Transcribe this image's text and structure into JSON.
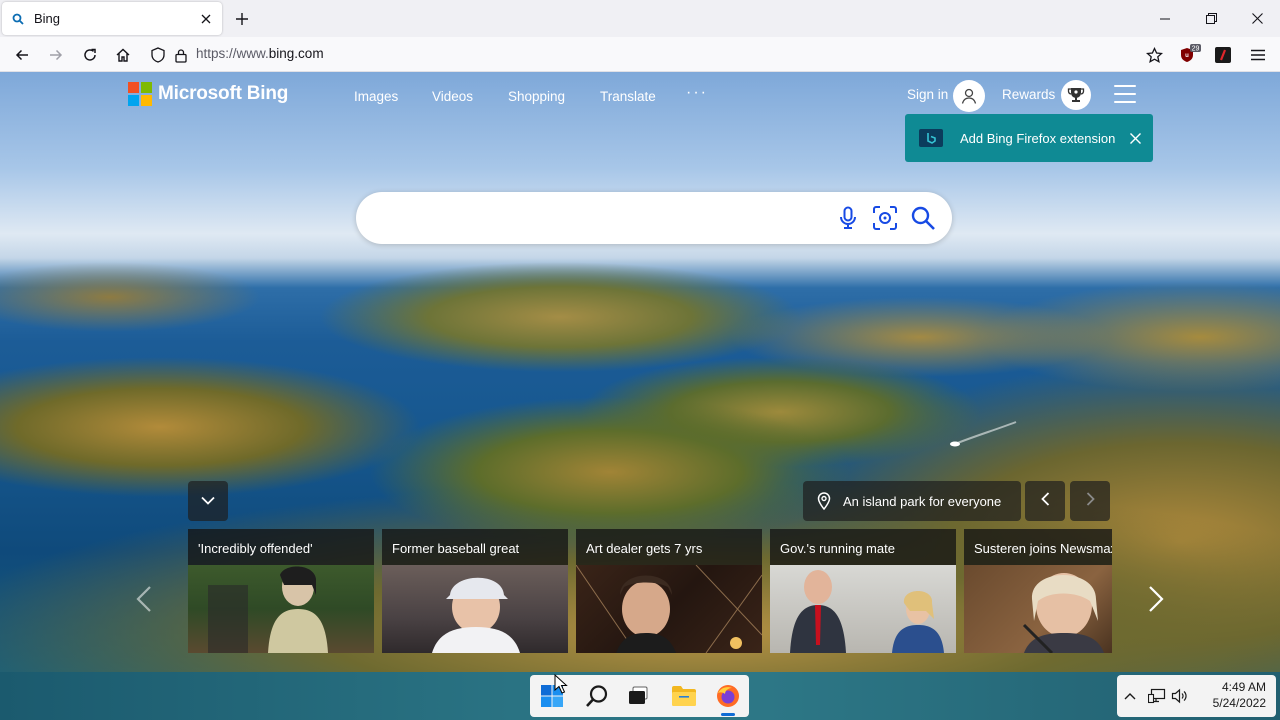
{
  "browser": {
    "tab": {
      "title": "Bing"
    },
    "url": {
      "scheme": "https://www.",
      "host": "bing.com"
    },
    "extension_badge_count": "29"
  },
  "header": {
    "logo_text": "Microsoft Bing",
    "nav": [
      "Images",
      "Videos",
      "Shopping",
      "Translate"
    ],
    "more": "···",
    "sign_in": "Sign in",
    "rewards": "Rewards"
  },
  "banner": {
    "text": "Add Bing Firefox extension"
  },
  "search": {
    "placeholder": "",
    "value": ""
  },
  "image_caption": "An island park for everyone",
  "news": [
    {
      "headline": "'Incredibly offended'"
    },
    {
      "headline": "Former baseball great"
    },
    {
      "headline": "Art dealer gets 7 yrs"
    },
    {
      "headline": "Gov.'s running mate"
    },
    {
      "headline": "Susteren joins Newsmax"
    }
  ],
  "taskbar": {
    "time": "4:49 AM",
    "date": "5/24/2022"
  },
  "colors": {
    "bing_teal": "#0f8a94",
    "ms_red": "#f25022",
    "ms_green": "#7fba00",
    "ms_blue": "#00a4ef",
    "ms_yellow": "#ffb900",
    "search_icon_blue": "#174ae4"
  },
  "icons": [
    "search-icon",
    "close-icon",
    "plus-icon",
    "back-icon",
    "forward-icon",
    "reload-icon",
    "home-icon",
    "shield-icon",
    "lock-icon",
    "star-icon",
    "ublock-icon",
    "extension-icon",
    "menu-icon",
    "microphone-icon",
    "visual-search-icon",
    "user-icon",
    "trophy-icon",
    "chevron-down-icon",
    "map-pin-icon",
    "chevron-left-icon",
    "chevron-right-icon",
    "windows-start-icon",
    "taskbar-search-icon",
    "task-view-icon",
    "file-explorer-icon",
    "firefox-icon",
    "chevron-up-icon",
    "network-icon",
    "volume-icon"
  ]
}
